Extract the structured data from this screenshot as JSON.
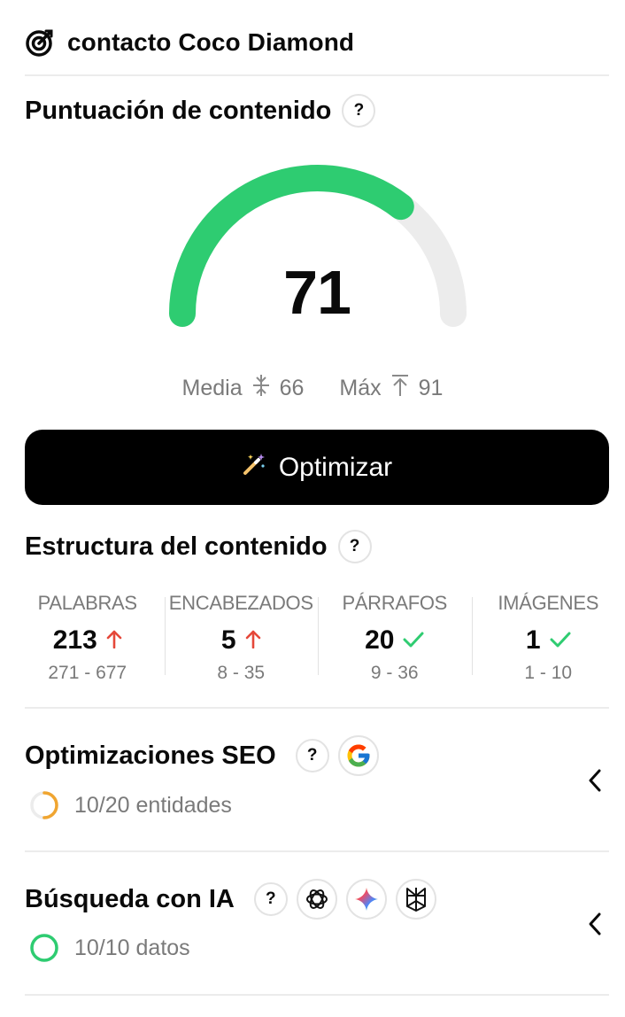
{
  "header": {
    "title": "contacto Coco Diamond"
  },
  "score_section": {
    "title": "Puntuación de contenido",
    "help": "?",
    "score": "71",
    "score_fraction": 0.71,
    "media_label": "Media",
    "media_value": "66",
    "max_label": "Máx",
    "max_value": "91",
    "colors": {
      "filled": "#2ecc71",
      "track": "#ececec"
    }
  },
  "optimize_button": {
    "label": "Optimizar"
  },
  "structure": {
    "title": "Estructura del contenido",
    "help": "?",
    "metrics": [
      {
        "label": "PALABRAS",
        "value": "213",
        "indicator": "arrow-up-icon",
        "range": "271 - 677"
      },
      {
        "label": "ENCABEZADOS",
        "value": "5",
        "indicator": "arrow-up-icon",
        "range": "8 - 35"
      },
      {
        "label": "PÁRRAFOS",
        "value": "20",
        "indicator": "check-icon",
        "range": "9 - 36"
      },
      {
        "label": "IMÁGENES",
        "value": "1",
        "indicator": "check-icon",
        "range": "1 - 10"
      }
    ]
  },
  "seo": {
    "title": "Optimizaciones SEO",
    "help": "?",
    "progress_text": "10/20 entidades",
    "progress_fraction": 0.5,
    "progress_color": "#f0a530",
    "brand_icons": [
      "google-icon"
    ]
  },
  "ai_search": {
    "title": "Búsqueda con IA",
    "help": "?",
    "progress_text": "10/10 datos",
    "progress_fraction": 1.0,
    "progress_color": "#2ecc71",
    "brand_icons": [
      "chatgpt-icon",
      "gemini-icon",
      "perplexity-icon"
    ]
  }
}
